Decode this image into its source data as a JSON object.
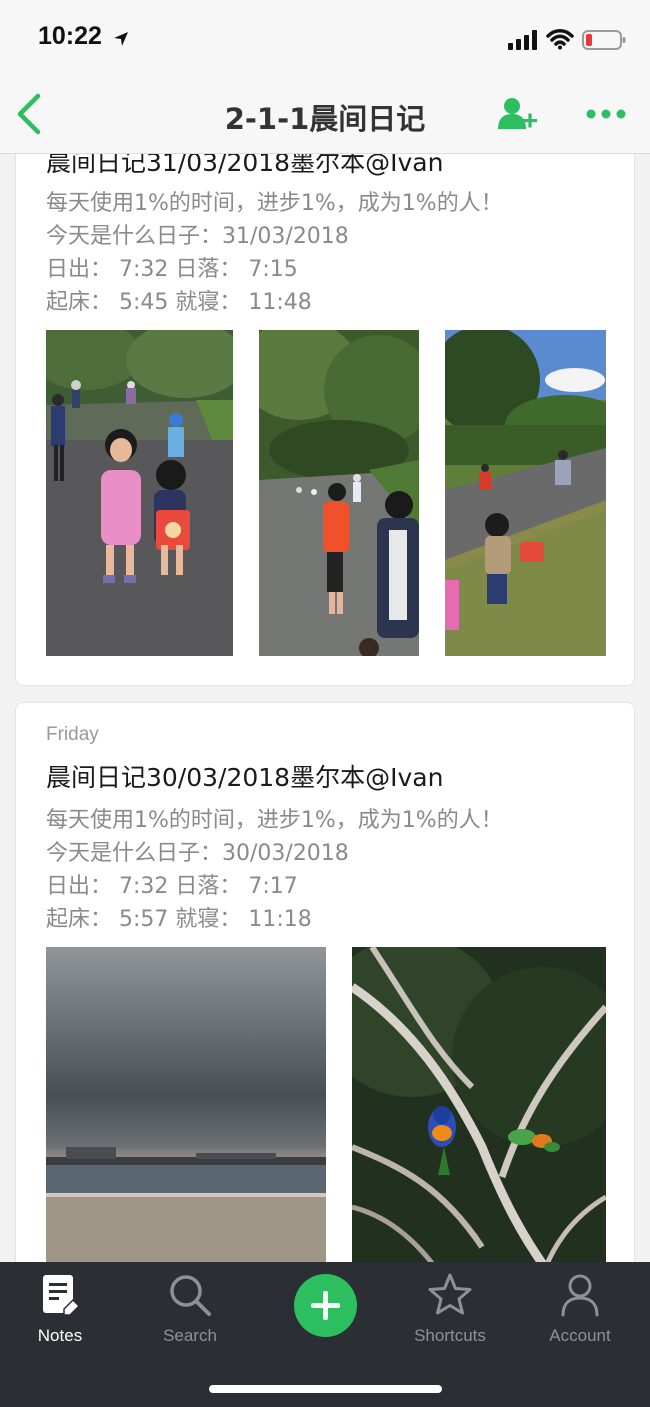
{
  "status_bar": {
    "time": "10:22"
  },
  "nav": {
    "title": "2-1-1晨间日记"
  },
  "notes": [
    {
      "title": "晨间日记31/03/2018墨尔本@Ivan",
      "lines": [
        "每天使用1%的时间，进步1%，成为1%的人！",
        "今天是什么日子：31/03/2018",
        "日出： 7:32 日落： 7:15",
        "起床： 5:45 就寝： 11:48"
      ]
    },
    {
      "day": "Friday",
      "title": "晨间日记30/03/2018墨尔本@Ivan",
      "lines": [
        "每天使用1%的时间，进步1%，成为1%的人！",
        "今天是什么日子：30/03/2018",
        "日出： 7:32 日落： 7:17",
        "起床： 5:57 就寝： 11:18"
      ]
    }
  ],
  "tab_bar": {
    "notes_label": "Notes",
    "search_label": "Search",
    "shortcuts_label": "Shortcuts",
    "account_label": "Account",
    "accent_color": "#2dbe60"
  }
}
